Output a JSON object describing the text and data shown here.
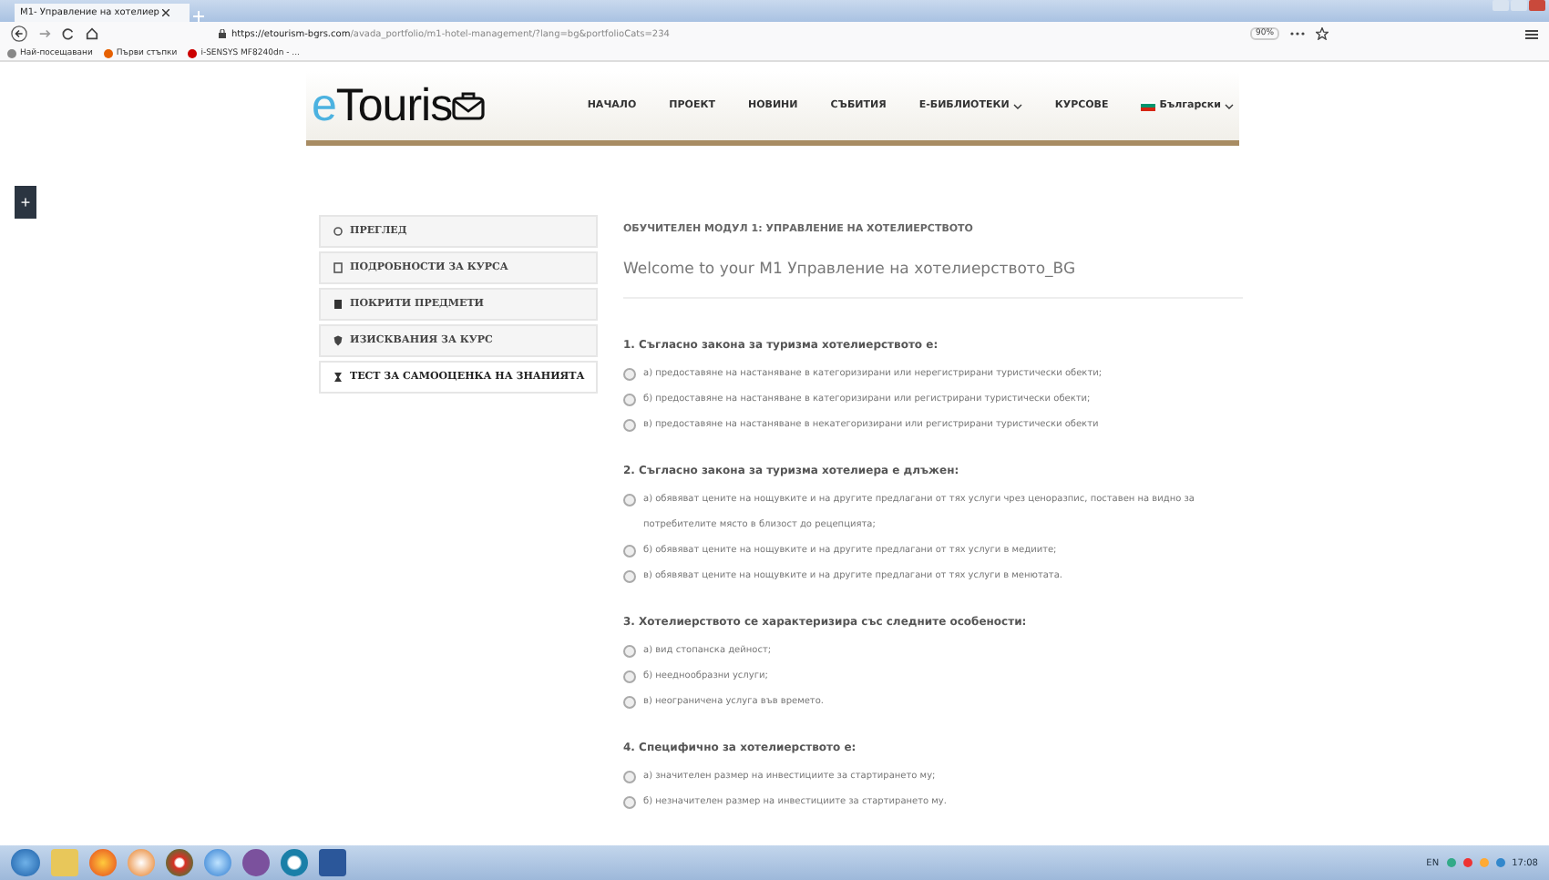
{
  "browser": {
    "tab_title": "M1- Управление на хотелиер",
    "url_host": "https://etourism-bgrs.com",
    "url_path": "/avada_portfolio/m1-hotel-management/?lang=bg&portfolioCats=234",
    "zoom": "90%",
    "bookmarks": [
      "Най-посещавани",
      "Първи стъпки",
      "i-SENSYS MF8240dn - ..."
    ]
  },
  "site": {
    "logo_prefix": "e",
    "logo_text": "Touris",
    "nav": [
      {
        "label": "НАЧАЛО",
        "dropdown": false
      },
      {
        "label": "ПРОЕКТ",
        "dropdown": false
      },
      {
        "label": "НОВИНИ",
        "dropdown": false
      },
      {
        "label": "СЪБИТИЯ",
        "dropdown": false
      },
      {
        "label": "Е-БИБЛИОТЕКИ",
        "dropdown": true
      },
      {
        "label": "КУРСОВЕ",
        "dropdown": false
      },
      {
        "label": "Български",
        "dropdown": true,
        "kind": "language"
      }
    ]
  },
  "side_toggle": "+",
  "sidebar": [
    {
      "label": "ПРЕГЛЕД",
      "selected": false
    },
    {
      "label": "ПОДРОБНОСТИ ЗА КУРСА",
      "selected": false
    },
    {
      "label": "ПОКРИТИ ПРЕДМЕТИ",
      "selected": false
    },
    {
      "label": "ИЗИСКВАНИЯ ЗА КУРС",
      "selected": false
    },
    {
      "label": "ТЕСТ ЗА САМООЦЕНКА НА ЗНАНИЯТА",
      "selected": true
    }
  ],
  "module_title": "ОБУЧИТЕЛЕН МОДУЛ 1: УПРАВЛЕНИЕ НА  ХОТЕЛИЕРСТВОТО",
  "welcome": "Welcome to your M1 Управление на хотелиерството_BG",
  "questions": [
    {
      "text": "1. Съгласно закона за туризма хотелиерството е:",
      "options": [
        {
          "label": "а) предоставяне на настаняване в категоризирани или нерегистрирани туристически обекти;",
          "checked": false
        },
        {
          "label": "б) предоставяне на настаняване в категоризирани или регистрирани туристически обекти;",
          "checked": false
        },
        {
          "label": "в) предоставяне на настаняване в некатегоризирани или регистрирани туристически обекти",
          "checked": false
        }
      ]
    },
    {
      "text": "2. Съгласно закона за туризма хотелиера е длъжен:",
      "options": [
        {
          "label": "а) обявяват цените на нощувките и на другите предлагани от тях услуги чрез ценоразпис, поставен на видно за потребителите място в близост до рецепцията;",
          "checked": false
        },
        {
          "label": "б) обявяват цените на нощувките и на другите предлагани от тях услуги в медиите;",
          "checked": false
        },
        {
          "label": "в) обявяват цените на нощувките и на другите предлагани от тях услуги в менютата.",
          "checked": false
        }
      ]
    },
    {
      "text": "3. Хотелиерството се характеризира със следните особености:",
      "options": [
        {
          "label": "а) вид стопанска дейност;",
          "checked": false
        },
        {
          "label": "б) нееднообразни услуги;",
          "checked": false
        },
        {
          "label": "в) неограничена услуга във времето.",
          "checked": false
        }
      ]
    },
    {
      "text": "4. Специфично за хотелиерството е:",
      "options": [
        {
          "label": "а) значителен размер на инвестициите за стартирането му;",
          "checked": false
        },
        {
          "label": "б) незначителен размер на инвестициите за стартирането му.",
          "checked": false
        }
      ]
    }
  ],
  "taskbar": {
    "language": "EN",
    "time": "17:08"
  }
}
